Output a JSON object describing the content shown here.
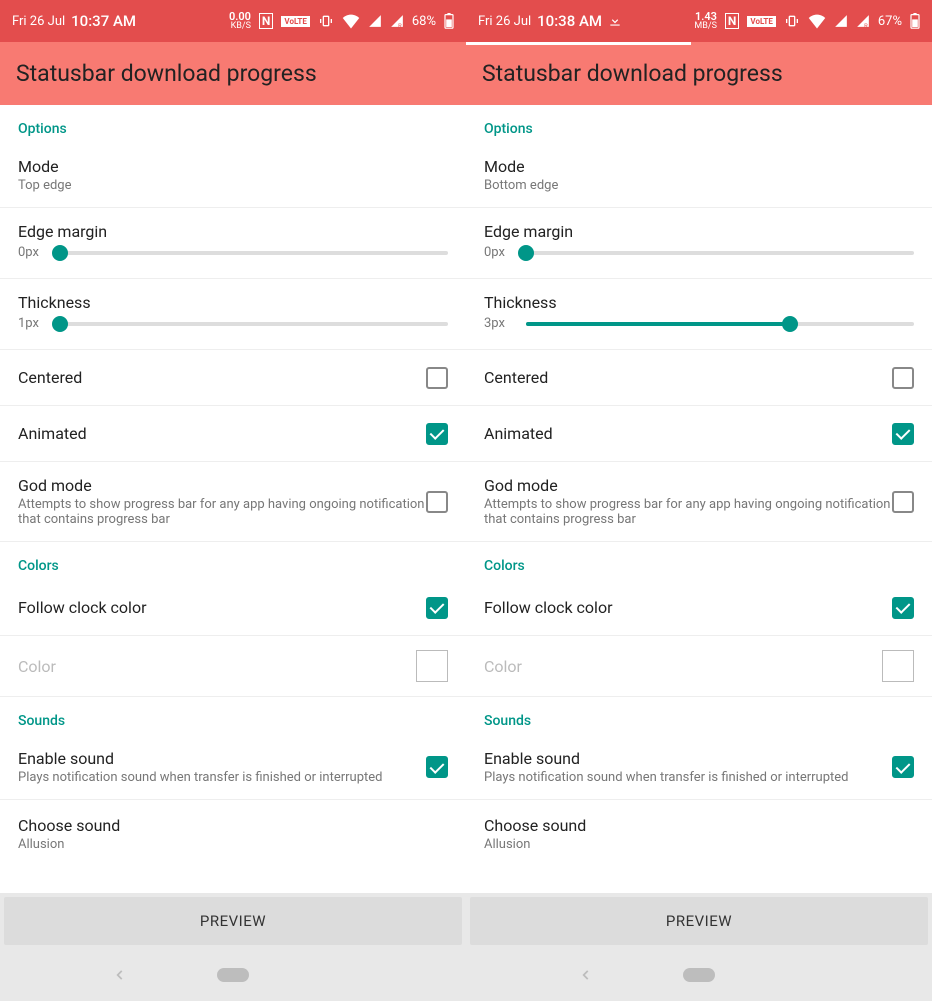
{
  "screens": [
    {
      "statusbar": {
        "date": "Fri 26 Jul",
        "time": "10:37 AM",
        "speed_top": "0.00",
        "speed_bot": "KB/S",
        "extra_icon": false,
        "nfc": "N",
        "volte": "VoLTE",
        "battery_pct": "68%"
      },
      "title": "Statusbar download progress",
      "tab_indicator_w": 0,
      "sections": {
        "options_header": "Options",
        "mode_label": "Mode",
        "mode_value": "Top edge",
        "edge_label": "Edge margin",
        "edge_value": "0px",
        "edge_pct": 0,
        "thick_label": "Thickness",
        "thick_value": "1px",
        "thick_pct": 0,
        "centered_label": "Centered",
        "centered_checked": false,
        "animated_label": "Animated",
        "animated_checked": true,
        "god_label": "God mode",
        "god_sub": "Attempts to show progress bar for any app having ongoing notification that contains progress bar",
        "god_checked": false,
        "colors_header": "Colors",
        "follow_label": "Follow clock color",
        "follow_checked": true,
        "color_label": "Color",
        "sounds_header": "Sounds",
        "enable_sound_label": "Enable sound",
        "enable_sound_sub": "Plays notification sound when transfer is finished or interrupted",
        "enable_sound_checked": true,
        "choose_sound_label": "Choose sound",
        "choose_sound_value": "Allusion"
      },
      "preview_btn": "PREVIEW"
    },
    {
      "statusbar": {
        "date": "Fri 26 Jul",
        "time": "10:38 AM",
        "speed_top": "1.43",
        "speed_bot": "MB/S",
        "extra_icon": true,
        "nfc": "N",
        "volte": "VoLTE",
        "battery_pct": "67%"
      },
      "title": "Statusbar download progress",
      "tab_indicator_w": 225,
      "sections": {
        "options_header": "Options",
        "mode_label": "Mode",
        "mode_value": "Bottom edge",
        "edge_label": "Edge margin",
        "edge_value": "0px",
        "edge_pct": 0,
        "thick_label": "Thickness",
        "thick_value": "3px",
        "thick_pct": 68,
        "centered_label": "Centered",
        "centered_checked": false,
        "animated_label": "Animated",
        "animated_checked": true,
        "god_label": "God mode",
        "god_sub": "Attempts to show progress bar for any app having ongoing notification that contains progress bar",
        "god_checked": false,
        "colors_header": "Colors",
        "follow_label": "Follow clock color",
        "follow_checked": true,
        "color_label": "Color",
        "sounds_header": "Sounds",
        "enable_sound_label": "Enable sound",
        "enable_sound_sub": "Plays notification sound when transfer is finished or interrupted",
        "enable_sound_checked": true,
        "choose_sound_label": "Choose sound",
        "choose_sound_value": "Allusion"
      },
      "preview_btn": "PREVIEW"
    }
  ]
}
